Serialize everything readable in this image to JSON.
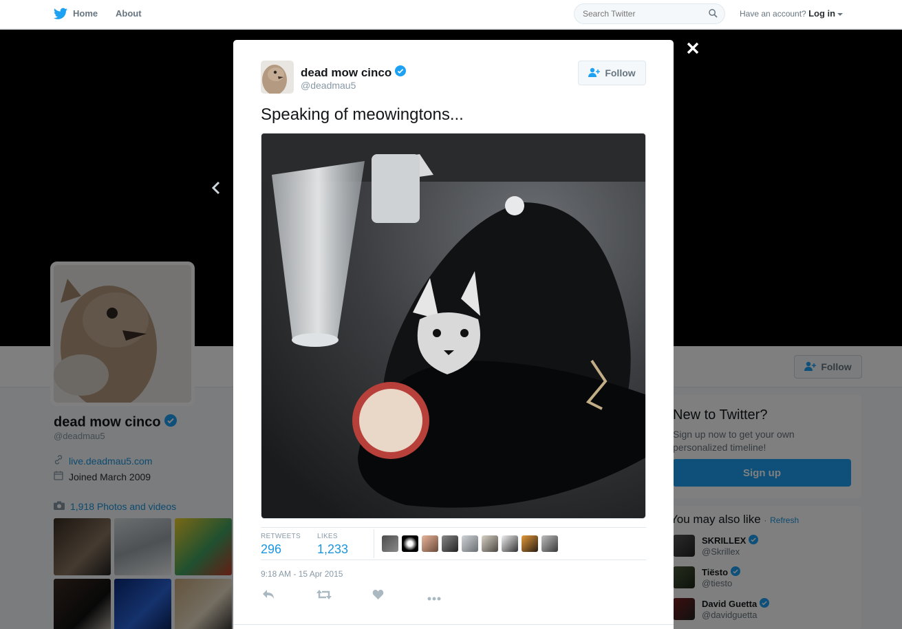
{
  "nav": {
    "home_label": "Home",
    "about_label": "About",
    "search_placeholder": "Search Twitter",
    "have_account": "Have an account?",
    "login_label": "Log in"
  },
  "profile": {
    "name": "dead mow cinco",
    "handle": "@deadmau5",
    "website": "live.deadmau5.com",
    "joined": "Joined March 2009",
    "photos_label": "1,918 Photos and videos",
    "follow_label": "Follow"
  },
  "signup_box": {
    "title": "New to Twitter?",
    "text": "Sign up now to get your own personalized timeline!",
    "button": "Sign up"
  },
  "who_to_follow": {
    "title": "You may also like",
    "dot": "·",
    "refresh": "Refresh",
    "items": [
      {
        "name": "SKRILLEX",
        "handle": "@Skrillex"
      },
      {
        "name": "Tiësto",
        "handle": "@tiesto"
      },
      {
        "name": "David Guetta",
        "handle": "@davidguetta"
      }
    ]
  },
  "tweet": {
    "name": "dead mow cinco",
    "handle": "@deadmau5",
    "follow_label": "Follow",
    "text": "Speaking of meowingtons...",
    "retweets_label": "RETWEETS",
    "retweets": "296",
    "likes_label": "LIKES",
    "likes": "1,233",
    "timestamp": "9:18 AM - 15 Apr 2015"
  },
  "colors": {
    "accent": "#1da1f2",
    "link": "#1b95e0",
    "verified": "#1da1f2"
  },
  "icons": [
    "twitter-bird-icon",
    "home-icon",
    "search-icon",
    "caret-down-icon",
    "close-icon",
    "chevron-left-icon",
    "verified-badge-icon",
    "follow-person-icon",
    "link-icon",
    "calendar-icon",
    "camera-icon",
    "reply-icon",
    "retweet-icon",
    "heart-icon",
    "more-icon"
  ]
}
